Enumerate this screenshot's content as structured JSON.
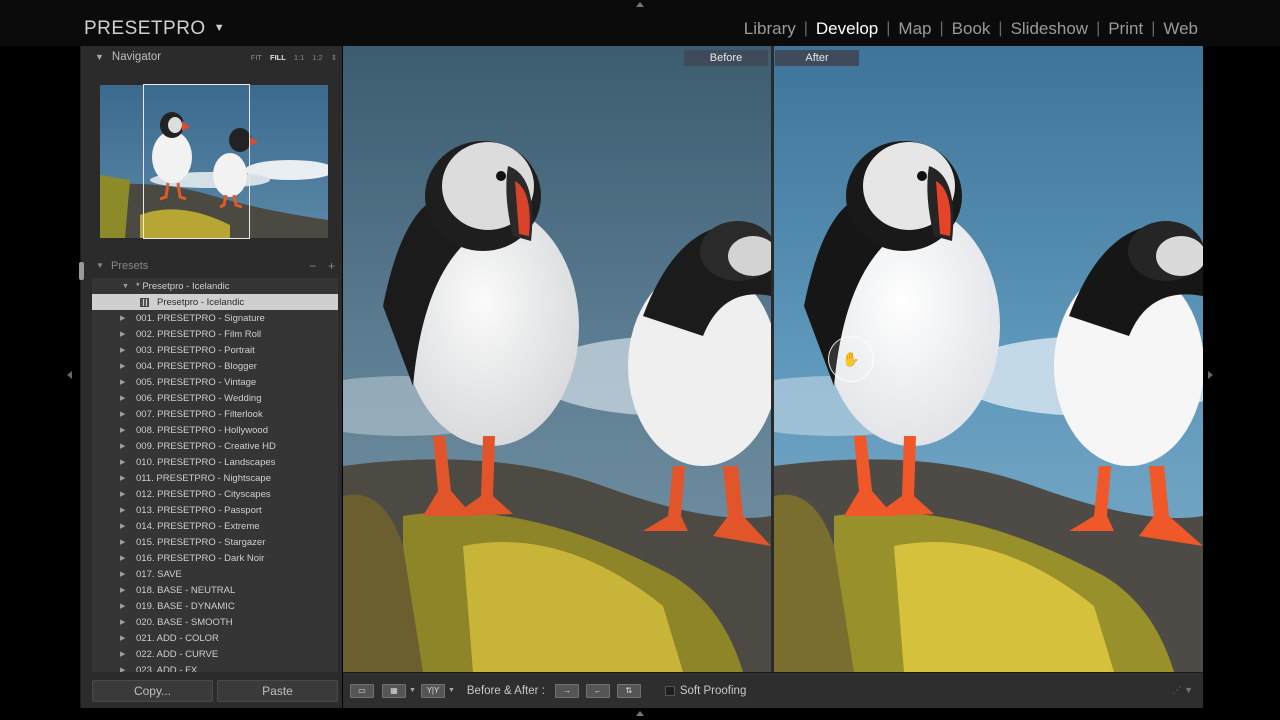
{
  "app": {
    "brand": "PRESETPRO",
    "brand_caret": "▼"
  },
  "modules": [
    {
      "label": "Library",
      "active": false
    },
    {
      "label": "Develop",
      "active": true
    },
    {
      "label": "Map",
      "active": false
    },
    {
      "label": "Book",
      "active": false
    },
    {
      "label": "Slideshow",
      "active": false
    },
    {
      "label": "Print",
      "active": false
    },
    {
      "label": "Web",
      "active": false
    }
  ],
  "navigator": {
    "title": "Navigator",
    "zoom_options": [
      "FIT",
      "FILL",
      "1:1",
      "1:2"
    ],
    "active_zoom": "FILL"
  },
  "presets": {
    "title": "Presets",
    "minus": "−",
    "plus": "+",
    "open_folder": "* Presetpro - Icelandic",
    "selected_preset": "Presetpro - Icelandic",
    "folders": [
      "001. PRESETPRO - Signature",
      "002. PRESETPRO - Film Roll",
      "003. PRESETPRO - Portrait",
      "004. PRESETPRO - Blogger",
      "005. PRESETPRO - Vintage",
      "006. PRESETPRO - Wedding",
      "007. PRESETPRO - Filterlook",
      "008. PRESETPRO - Hollywood",
      "009. PRESETPRO - Creative HD",
      "010. PRESETPRO - Landscapes",
      "011. PRESETPRO - Nightscape",
      "012. PRESETPRO - Cityscapes",
      "013. PRESETPRO - Passport",
      "014. PRESETPRO - Extreme",
      "015. PRESETPRO - Stargazer",
      "016. PRESETPRO - Dark Noir",
      "017. SAVE",
      "018. BASE - NEUTRAL",
      "019. BASE - DYNAMIC",
      "020. BASE - SMOOTH",
      "021. ADD - COLOR",
      "022. ADD - CURVE",
      "023. ADD - FX"
    ]
  },
  "buttons": {
    "copy": "Copy...",
    "paste": "Paste"
  },
  "view": {
    "before_label": "Before",
    "after_label": "After"
  },
  "toolbar": {
    "before_after_label": "Before & After :",
    "yy_label": "Y|Y",
    "soft_proofing": "Soft Proofing",
    "soft_proofing_checked": false
  },
  "icons": {
    "loupe": "loupe-view-icon",
    "grid": "grid-view-icon",
    "swap_left": "copy-before-to-after-icon",
    "swap_right": "copy-after-to-before-icon",
    "swap": "swap-before-after-icon",
    "hand": "hand-cursor-icon"
  }
}
